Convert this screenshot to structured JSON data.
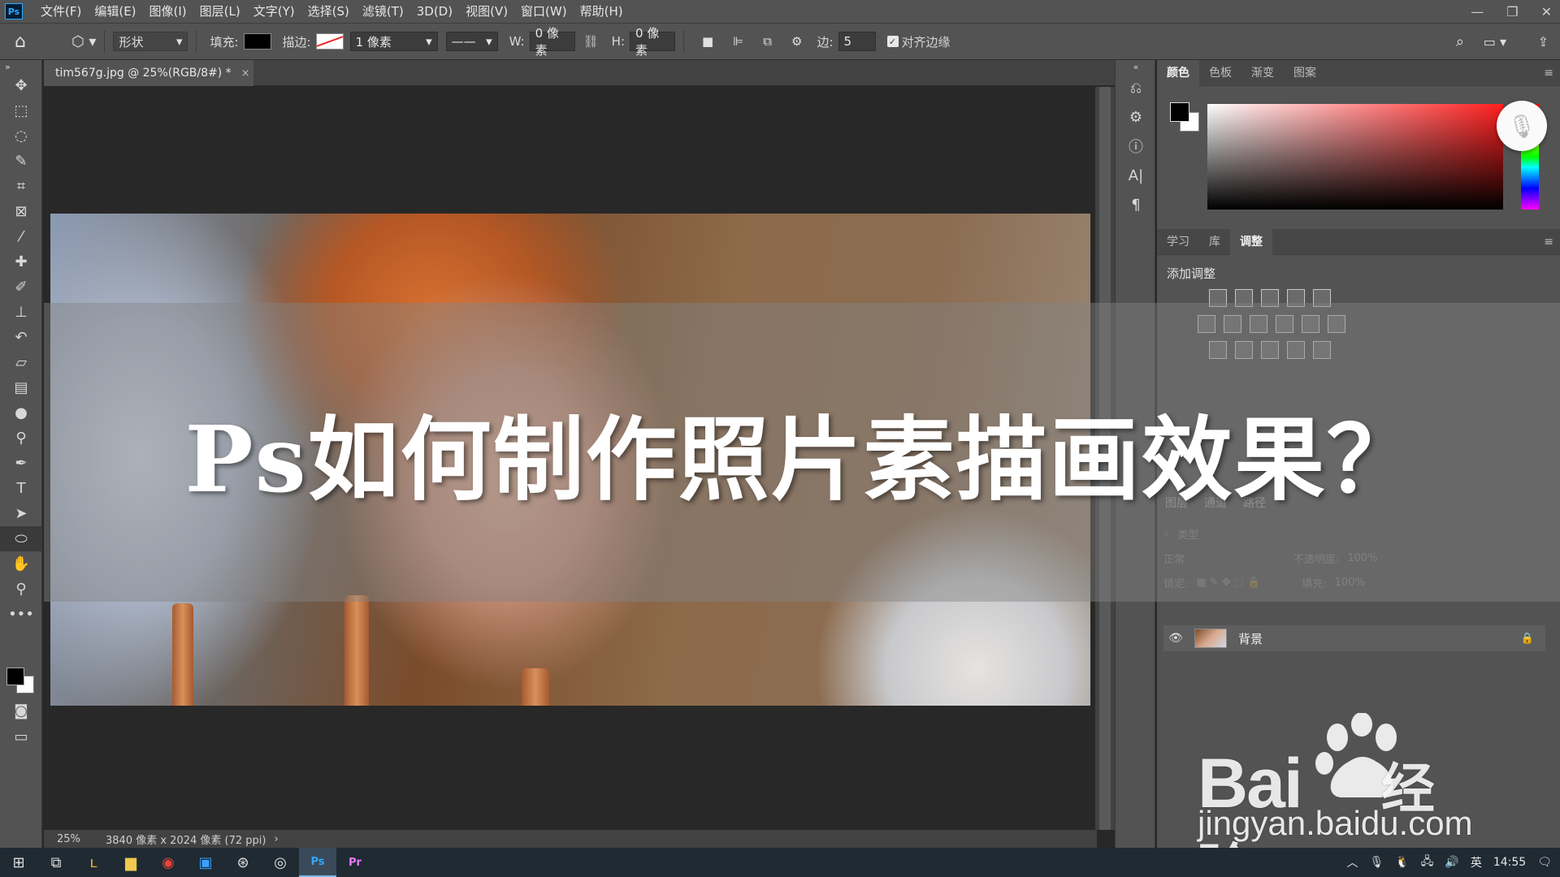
{
  "app": {
    "logo": "Ps",
    "menu": [
      "文件(F)",
      "编辑(E)",
      "图像(I)",
      "图层(L)",
      "文字(Y)",
      "选择(S)",
      "滤镜(T)",
      "3D(D)",
      "视图(V)",
      "窗口(W)",
      "帮助(H)"
    ],
    "window_controls": [
      "minimize-icon",
      "restore-icon",
      "close-icon"
    ]
  },
  "options": {
    "shape_mode": "形状",
    "fill_label": "填充:",
    "fill_color": "#000000",
    "stroke_label": "描边:",
    "stroke_width": "1 像素",
    "w_label": "W:",
    "w_value": "0 像素",
    "h_label": "H:",
    "h_value": "0 像素",
    "sides_label": "边:",
    "sides_value": "5",
    "align_edges_label": "对齐边缘",
    "align_edges_checked": true
  },
  "document": {
    "tab_title": "tim567g.jpg @ 25%(RGB/8#) *",
    "zoom": "25%",
    "info": "3840 像素 x 2024 像素 (72 ppi)"
  },
  "overlay": {
    "title": "Ps如何制作照片素描画效果？"
  },
  "panels": {
    "color_tabs": [
      "颜色",
      "色板",
      "渐变",
      "图案"
    ],
    "foreground": "#000000",
    "background": "#ffffff",
    "adjust_tabs": [
      "学习",
      "库",
      "调整"
    ],
    "adjust_title": "添加调整",
    "layers_tabs": [
      "图层",
      "通道",
      "路径"
    ],
    "layer_filter_placeholder": "类型",
    "blend_mode": "正常",
    "opacity_label": "不透明度:",
    "opacity_value": "100%",
    "lock_label": "锁定:",
    "fill_label": "填充:",
    "fill_value": "100%",
    "layer_name": "背景"
  },
  "watermark": {
    "brand_left": "Bai",
    "brand_right": "经验",
    "url": "jingyan.baidu.com"
  },
  "taskbar": {
    "ime": "英",
    "time": "14:55"
  }
}
